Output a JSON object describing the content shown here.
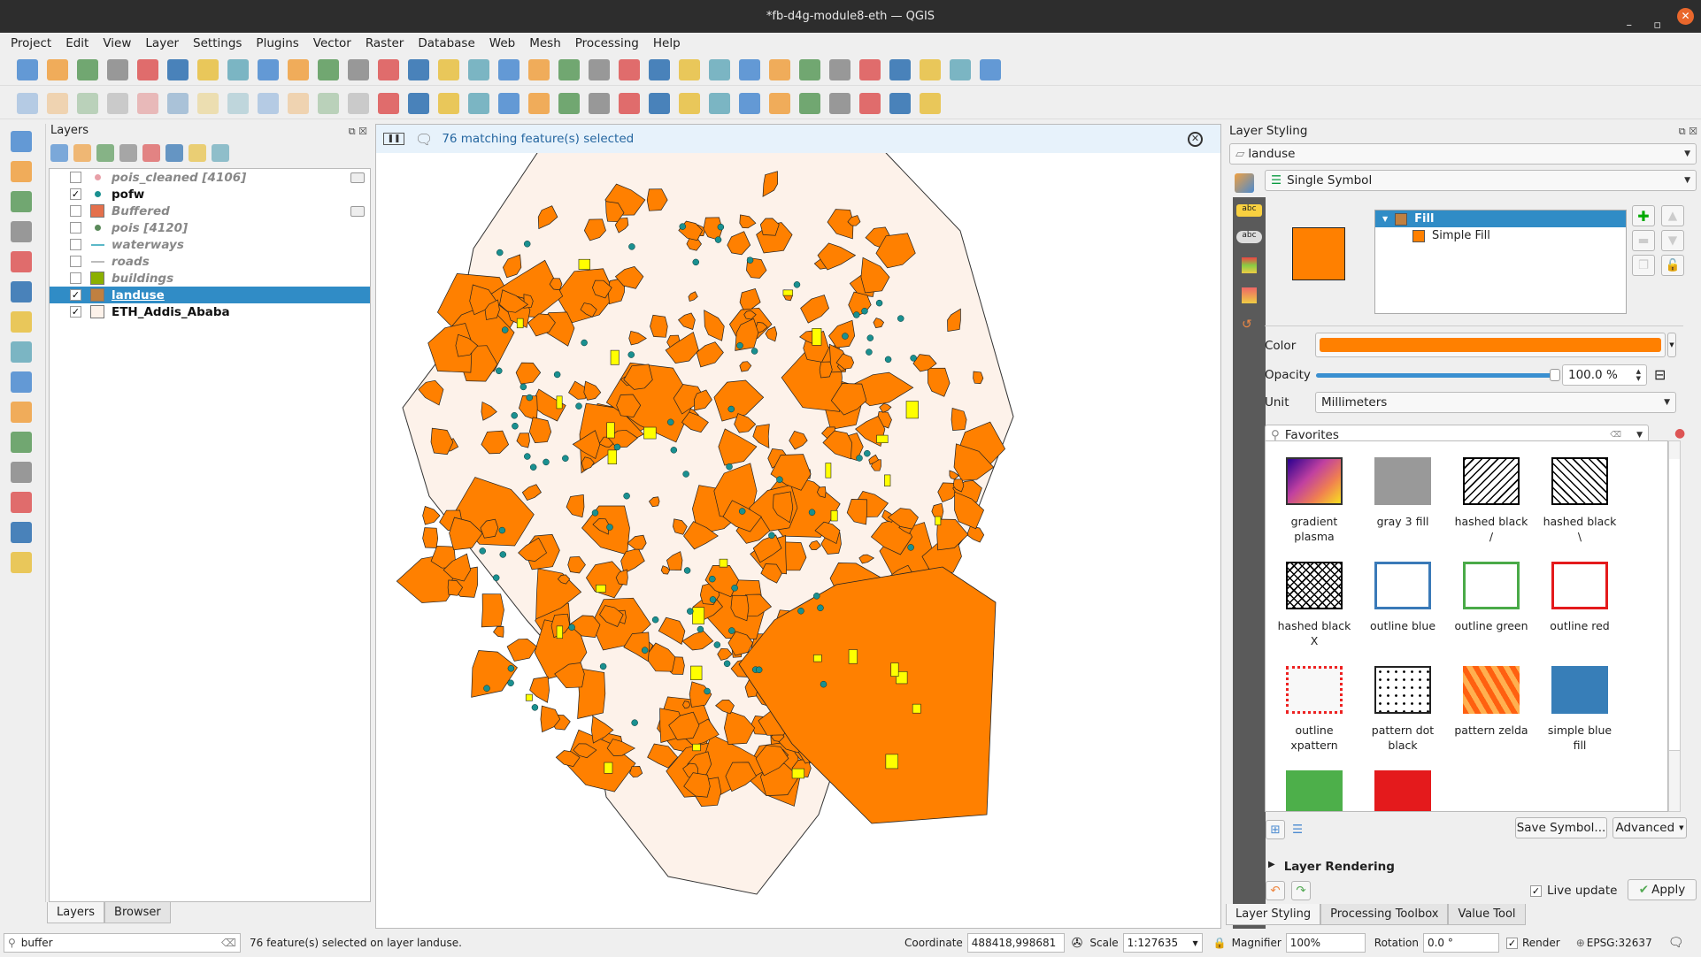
{
  "window": {
    "title": "*fb-d4g-module8-eth — QGIS",
    "controls": [
      "–",
      "▫",
      "✕"
    ]
  },
  "menu": [
    "Project",
    "Edit",
    "View",
    "Layer",
    "Settings",
    "Plugins",
    "Vector",
    "Raster",
    "Database",
    "Web",
    "Mesh",
    "Processing",
    "Help"
  ],
  "toolbar1": [
    "new-project",
    "open-project",
    "save-project",
    "save-as",
    "print-layout",
    "style-manager",
    "pan",
    "pan-to-selection",
    "zoom-in",
    "zoom-out",
    "zoom-full",
    "zoom-selection",
    "zoom-layer",
    "zoom-native",
    "zoom-last",
    "zoom-next",
    "new-bookmark",
    "show-bookmarks",
    "temporal",
    "refresh",
    "identify",
    "attribute-table",
    "field-calc",
    "processing",
    "statistics",
    "measure",
    "map-tips",
    "annotations",
    "text-annotation",
    "select-features",
    "select-by-attribute",
    "deselect",
    "select-by-location"
  ],
  "toolbar2": [
    "current-edits",
    "toggle-editing",
    "save-edits",
    "digitize",
    "vertex-tool",
    "modify-attributes",
    "delete",
    "cut",
    "copy",
    "paste",
    "undo",
    "redo",
    "label",
    "diagram",
    "label-pin",
    "label-highlight",
    "label-move",
    "label-rotate",
    "label-change",
    "label-show",
    "label-unpin",
    "globe",
    "python",
    "quickmapservices",
    "metasearch",
    "georeferencer",
    "help",
    "plugin-a",
    "plugin-b",
    "search",
    "qgis-plugin"
  ],
  "left_toolbar": [
    "data-source-manager",
    "new-geopackage",
    "new-shapefile",
    "new-temp-layer",
    "new-virtual-layer",
    "add-vector",
    "add-raster",
    "add-mesh",
    "add-delimited",
    "add-spatialite",
    "add-postgis",
    "add-wms",
    "add-wfs",
    "add-wcs",
    "add-virtual"
  ],
  "layers_panel": {
    "title": "Layers",
    "tools": [
      "style",
      "add-group",
      "visibility",
      "filter",
      "expression-filter",
      "expand-all",
      "collapse-all",
      "remove-layer"
    ],
    "items": [
      {
        "name": "pois_cleaned [4106]",
        "checked": false,
        "symbol": "point",
        "color": "#e8a0a8",
        "memory": true,
        "visible_on": false
      },
      {
        "name": "pofw",
        "checked": true,
        "symbol": "point",
        "color": "#1a9090",
        "memory": false,
        "visible_on": true
      },
      {
        "name": "Buffered",
        "checked": false,
        "symbol": "fill",
        "color": "#e4704c",
        "memory": true,
        "visible_on": false
      },
      {
        "name": "pois [4120]",
        "checked": false,
        "symbol": "point",
        "color": "#5a8a5a",
        "memory": false,
        "visible_on": false
      },
      {
        "name": "waterways",
        "checked": false,
        "symbol": "line",
        "color": "#5bb8c8",
        "memory": false,
        "visible_on": false
      },
      {
        "name": "roads",
        "checked": false,
        "symbol": "line",
        "color": "#bbbbbb",
        "memory": false,
        "visible_on": false
      },
      {
        "name": "buildings",
        "checked": false,
        "symbol": "fill",
        "color": "#8bb000",
        "memory": false,
        "visible_on": false
      },
      {
        "name": "landuse",
        "checked": true,
        "symbol": "fill",
        "color": "#c08040",
        "memory": false,
        "visible_on": true,
        "selected": true
      },
      {
        "name": "ETH_Addis_Ababa",
        "checked": true,
        "symbol": "fill",
        "color": "#fdf2ea",
        "memory": false,
        "visible_on": true
      }
    ]
  },
  "left_tabs": [
    "Layers",
    "Browser"
  ],
  "map": {
    "message": "76 matching feature(s) selected",
    "fill_color": "#ff8000",
    "boundary_color": "#fdf2ea",
    "selection_color": "#ffff00",
    "point_color": "#1a9090"
  },
  "styling": {
    "title": "Layer Styling",
    "layer": "landuse",
    "renderer": "Single Symbol",
    "tree": [
      "Fill",
      "Simple Fill"
    ],
    "color_label": "Color",
    "color_value": "#ff8000",
    "opacity_label": "Opacity",
    "opacity_value": "100.0 %",
    "opacity_fraction": 1.0,
    "unit_label": "Unit",
    "unit_value": "Millimeters",
    "search_value": "Favorites",
    "symbols": [
      {
        "name": "gradient plasma",
        "kind": "gradient"
      },
      {
        "name": "gray 3 fill",
        "kind": "gray"
      },
      {
        "name": "hashed black /",
        "kind": "hash1"
      },
      {
        "name": "hashed black \\",
        "kind": "hash2"
      },
      {
        "name": "hashed black X",
        "kind": "hashx"
      },
      {
        "name": "outline blue",
        "kind": "ob"
      },
      {
        "name": "outline green",
        "kind": "og"
      },
      {
        "name": "outline red",
        "kind": "or"
      },
      {
        "name": "outline xpattern",
        "kind": "xp"
      },
      {
        "name": "pattern dot black",
        "kind": "dots"
      },
      {
        "name": "pattern zelda",
        "kind": "zelda"
      },
      {
        "name": "simple blue fill",
        "kind": "blue"
      },
      {
        "name": "",
        "kind": "green"
      },
      {
        "name": "",
        "kind": "red"
      }
    ],
    "save_symbol": "Save Symbol...",
    "advanced": "Advanced",
    "layer_rendering": "Layer Rendering",
    "live_update": "Live update",
    "apply": "Apply"
  },
  "right_tabs": [
    "Layer Styling",
    "Processing Toolbox",
    "Value Tool"
  ],
  "status": {
    "search": "buffer",
    "message": "76 feature(s) selected on layer landuse.",
    "coordinate_label": "Coordinate",
    "coordinate": "488418,998681",
    "scale_label": "Scale",
    "scale": "1:127635",
    "magnifier_label": "Magnifier",
    "magnifier": "100%",
    "rotation_label": "Rotation",
    "rotation": "0.0 °",
    "render_label": "Render",
    "crs": "EPSG:32637"
  }
}
